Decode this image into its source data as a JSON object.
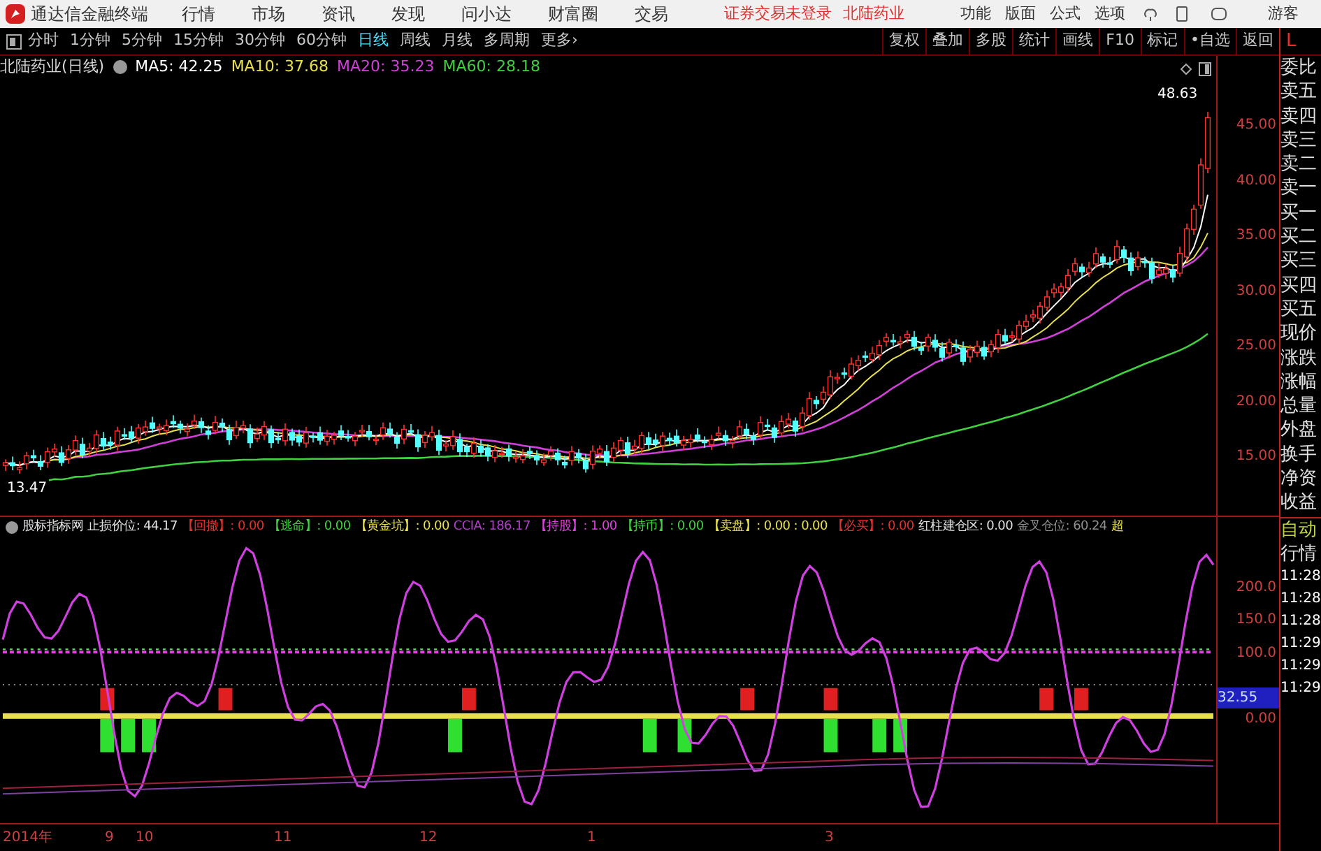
{
  "titlebar": {
    "app_title": "通达信金融终端",
    "menus": [
      "行情",
      "市场",
      "资讯",
      "发现",
      "问小达",
      "财富圈",
      "交易"
    ],
    "notice": "证券交易未登录",
    "stock": "北陆药业",
    "tools": [
      "功能",
      "版面",
      "公式",
      "选项"
    ],
    "user": "游客"
  },
  "toolbar": {
    "periods": [
      {
        "label": "分时",
        "selected": false
      },
      {
        "label": "1分钟",
        "selected": false
      },
      {
        "label": "5分钟",
        "selected": false
      },
      {
        "label": "15分钟",
        "selected": false
      },
      {
        "label": "30分钟",
        "selected": false
      },
      {
        "label": "60分钟",
        "selected": false
      },
      {
        "label": "日线",
        "selected": true
      },
      {
        "label": "周线",
        "selected": false
      },
      {
        "label": "月线",
        "selected": false
      },
      {
        "label": "多周期",
        "selected": false
      },
      {
        "label": "更多›",
        "selected": false
      }
    ],
    "buttons": [
      "复权",
      "叠加",
      "多股",
      "统计",
      "画线",
      "F10",
      "标记",
      "•自选",
      "返回"
    ]
  },
  "price_chart": {
    "legend_title": "北陆药业(日线)",
    "ma": [
      {
        "label": "MA5: 42.25",
        "color": "#ffffff"
      },
      {
        "label": "MA10: 37.68",
        "color": "#e8e04a"
      },
      {
        "label": "MA20: 35.23",
        "color": "#d040d8"
      },
      {
        "label": "MA60: 28.18",
        "color": "#40d040"
      }
    ],
    "high_label": "48.63",
    "low_label": "13.47",
    "yticks": [
      "45.00",
      "40.00",
      "35.00",
      "30.00",
      "25.00",
      "20.00",
      "15.00"
    ]
  },
  "indicator": {
    "title": "股标指标网",
    "fields": [
      {
        "text": "止损价位: 44.17",
        "color": "#e0e0e0"
      },
      {
        "text": "【回撤】: 0.00",
        "color": "#e03030"
      },
      {
        "text": "【逃命】: 0.00",
        "color": "#40d040"
      },
      {
        "text": "【黄金坑】: 0.00",
        "color": "#e8e04a"
      },
      {
        "text": "CCIA: 186.17",
        "color": "#b040c8"
      },
      {
        "text": "【持股】: 1.00",
        "color": "#e040e0"
      },
      {
        "text": "【持币】: 0.00",
        "color": "#40d040"
      },
      {
        "text": "【卖盘】: 0.00 : 0.00",
        "color": "#e8e04a"
      },
      {
        "text": "【必买】: 0.00",
        "color": "#e03030"
      },
      {
        "text": "红柱建仓区: 0.00",
        "color": "#e0e0e0"
      },
      {
        "text": "金叉仓位: 60.24",
        "color": "#909090"
      },
      {
        "text": "超",
        "color": "#e8e04a"
      }
    ],
    "yticks": [
      {
        "label": "200.0",
        "selected": false
      },
      {
        "label": "150.0",
        "selected": false
      },
      {
        "label": "100.0",
        "selected": false
      },
      {
        "label": "32.55",
        "selected": true
      },
      {
        "label": "0.00",
        "selected": false
      }
    ]
  },
  "time_axis": [
    "2014年",
    "9",
    "10",
    "11",
    "12",
    "1",
    "3"
  ],
  "side_panel": {
    "corner": "L",
    "quote_labels": [
      "委比",
      "卖五",
      "卖四",
      "卖三",
      "卖二",
      "卖一",
      "买一",
      "买二",
      "买三",
      "买四",
      "买五",
      "现价",
      "涨跌",
      "涨幅",
      "总量",
      "外盘",
      "换手",
      "净资",
      "收益"
    ],
    "mode_labels": [
      "自动",
      "行情"
    ],
    "times": [
      "11:28",
      "11:28",
      "11:28",
      "11:29",
      "11:29",
      "11:29"
    ]
  }
}
